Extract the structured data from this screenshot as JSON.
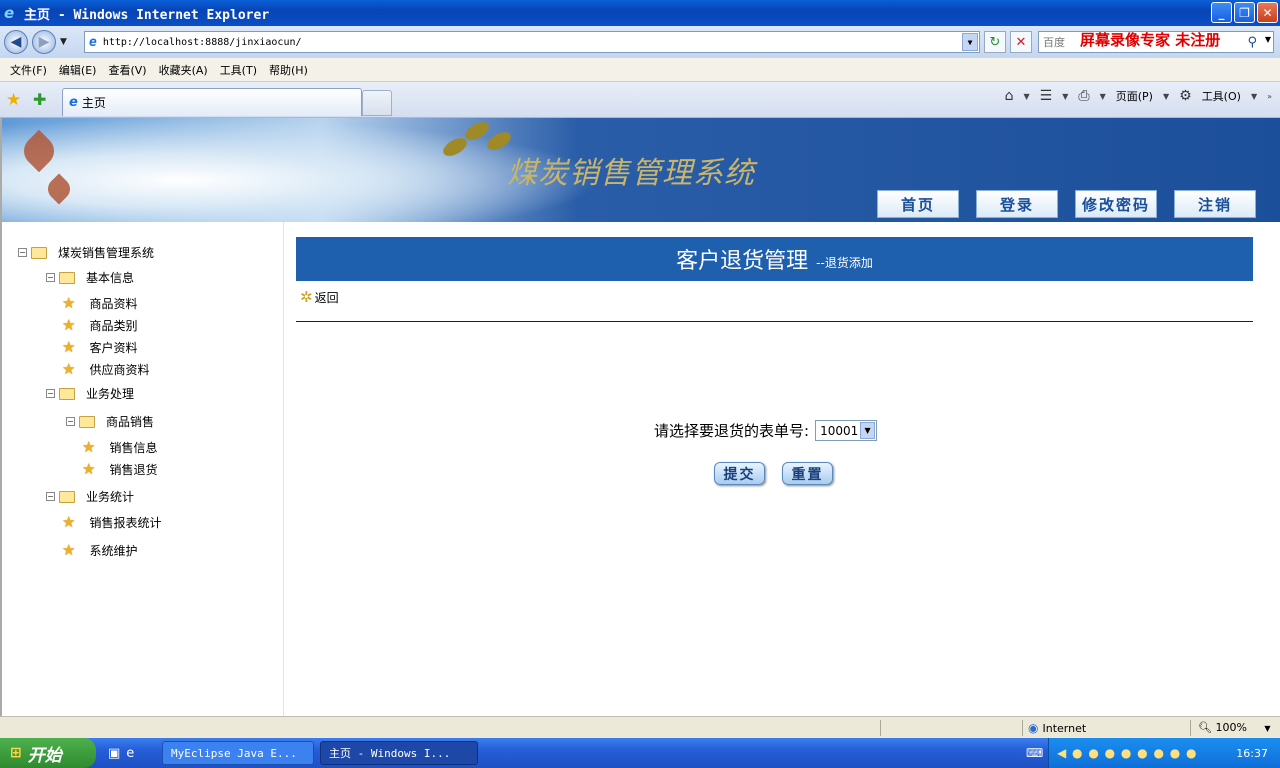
{
  "window": {
    "title": "主页 - Windows Internet Explorer"
  },
  "address": {
    "url": "http://localhost:8888/jinxiaocun/",
    "search_placeholder": "百度",
    "watermark": "屏幕录像专家 未注册"
  },
  "menu": [
    "文件(F)",
    "编辑(E)",
    "查看(V)",
    "收藏夹(A)",
    "工具(T)",
    "帮助(H)"
  ],
  "tab": {
    "label": "主页"
  },
  "commands": {
    "page": "页面(P)",
    "tools": "工具(O)"
  },
  "banner": {
    "system_title": "煤炭销售管理系统",
    "nav": [
      "首页",
      "登录",
      "修改密码",
      "注销"
    ]
  },
  "tree": {
    "root": "煤炭销售管理系统",
    "basic": "基本信息",
    "basic_items": [
      "商品资料",
      "商品类别",
      "客户资料",
      "供应商资料"
    ],
    "business": "业务处理",
    "sales": "商品销售",
    "sales_items": [
      "销售信息",
      "销售退货"
    ],
    "stats": "业务统计",
    "stats_items": [
      "销售报表统计",
      "系统维护"
    ]
  },
  "content": {
    "title": "客户退货管理",
    "subtitle": "--退货添加",
    "back": "返回",
    "form_label": "请选择要退货的表单号:",
    "order_selected": "10001",
    "submit": "提交",
    "reset": "重置"
  },
  "status": {
    "zone": "Internet",
    "zoom": "100%"
  },
  "taskbar": {
    "start": "开始",
    "item_a": "MyEclipse Java E...",
    "item_b": "主页 - Windows I...",
    "clock": "16:37"
  }
}
